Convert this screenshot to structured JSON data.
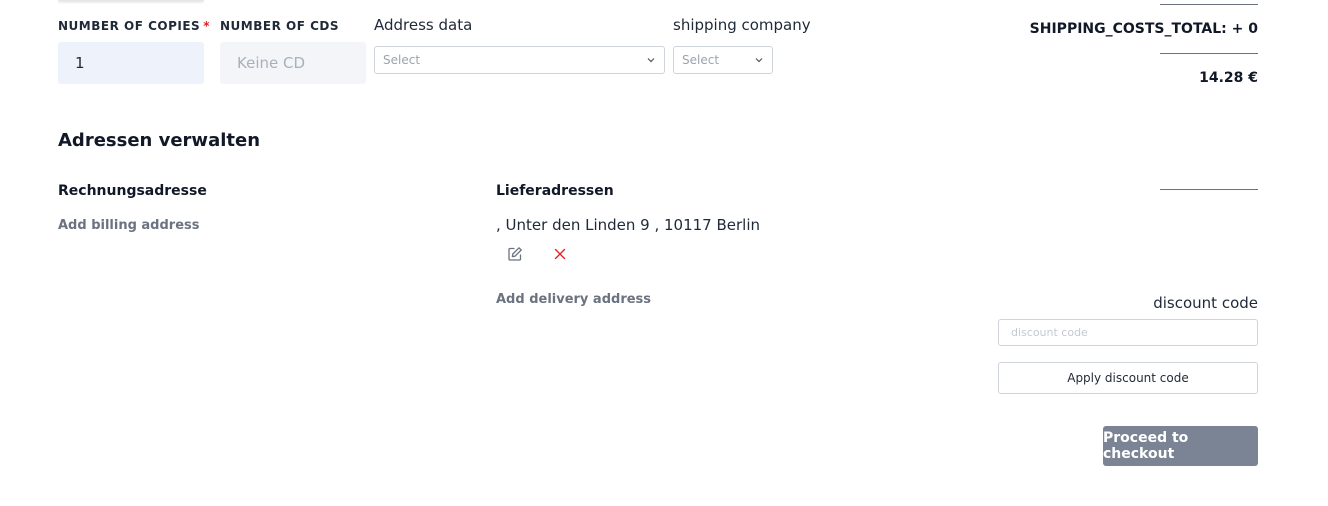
{
  "order_fields": {
    "copies_label": "NUMBER OF COPIES",
    "copies_required_mark": "*",
    "copies_value": "1",
    "cds_label": "NUMBER OF CDS",
    "cds_placeholder": "Keine CD",
    "address_label": "Address data",
    "address_select": "Select",
    "shipping_label": "shipping company",
    "shipping_select": "Select"
  },
  "totals": {
    "shipping_costs": "SHIPPING_COSTS_TOTAL: + 0",
    "price": "14.28 €"
  },
  "addresses": {
    "title": "Adressen verwalten",
    "billing_title": "Rechnungsadresse",
    "add_billing": "Add billing address",
    "delivery_title": "Lieferadressen",
    "delivery_entry": ", Unter den Linden 9 , 10117 Berlin",
    "add_delivery": "Add delivery address"
  },
  "icons": {
    "edit": "edit-icon",
    "delete": "close-icon",
    "chevron": "chevron-down-icon"
  },
  "discount": {
    "label": "discount code",
    "placeholder": "discount code",
    "apply_label": "Apply discount code"
  },
  "checkout": {
    "label": "Proceed to checkout"
  },
  "colors": {
    "input_bg": "#eef2fb",
    "delete_red": "#dc2626",
    "checkout_bg": "#7b8494",
    "muted_text": "#6b7280"
  }
}
